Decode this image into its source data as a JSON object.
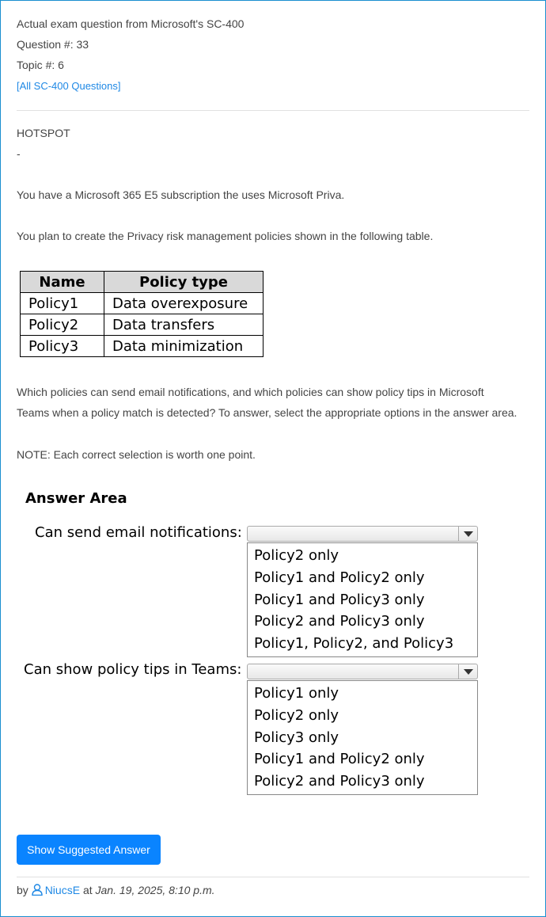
{
  "header": {
    "line1": "Actual exam question from Microsoft's SC-400",
    "question_no": "Question #: 33",
    "topic_no": "Topic #: 6",
    "all_questions_link": "[All SC-400 Questions]"
  },
  "question": {
    "type": "HOTSPOT",
    "dash": "-",
    "p1": "You have a Microsoft 365 E5 subscription the uses Microsoft Priva.",
    "p2": "You plan to create the Privacy risk management policies shown in the following table.",
    "p3_line1": "Which policies can send email notifications, and which policies can show policy tips in Microsoft",
    "p3_line2": "Teams when a policy match is detected? To answer, select the appropriate options in the answer area.",
    "note": "NOTE: Each correct selection is worth one point."
  },
  "policy_table": {
    "headers": [
      "Name",
      "Policy type"
    ],
    "rows": [
      [
        "Policy1",
        "Data overexposure"
      ],
      [
        "Policy2",
        "Data transfers"
      ],
      [
        "Policy3",
        "Data minimization"
      ]
    ]
  },
  "answer_area": {
    "title": "Answer Area",
    "q1": {
      "label": "Can send email notifications:",
      "options": [
        "Policy2 only",
        "Policy1 and Policy2 only",
        "Policy1 and Policy3 only",
        "Policy2 and Policy3 only",
        "Policy1, Policy2, and Policy3"
      ]
    },
    "q2": {
      "label": "Can show policy tips in Teams:",
      "options": [
        "Policy1 only",
        "Policy2 only",
        "Policy3 only",
        "Policy1 and Policy2 only",
        "Policy2 and Policy3 only"
      ]
    }
  },
  "actions": {
    "show_answer": "Show Suggested Answer"
  },
  "footer": {
    "by": "by",
    "user": "NiucsE",
    "at": "at",
    "date": "Jan. 19, 2025, 8:10 p.m."
  },
  "colors": {
    "accent": "#0a84ff",
    "link": "#1e88e5",
    "border": "#1a8fd0"
  }
}
